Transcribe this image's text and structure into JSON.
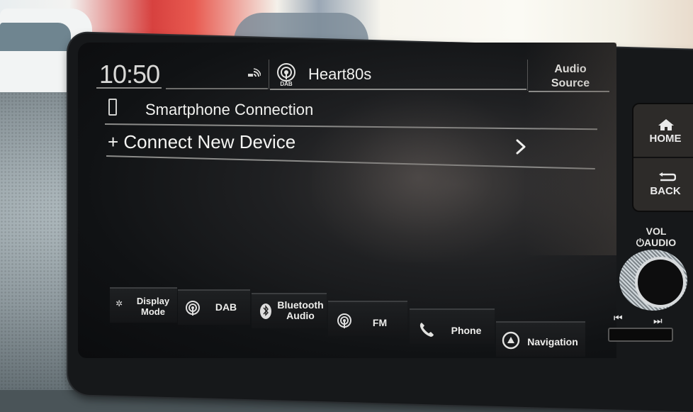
{
  "status_bar": {
    "time": "10:50",
    "signal_icon": "reception-signal-icon",
    "source_icon": "dab-radio-icon",
    "source_badge": "DAB",
    "station": "Heart80s"
  },
  "audio_source_button": {
    "line1": "Audio",
    "line2": "Source"
  },
  "content": {
    "section_icon": "smartphone-icon",
    "section_title": "Smartphone Connection",
    "items": [
      {
        "label": "+ Connect New Device",
        "icon": "chevron-right-icon"
      }
    ]
  },
  "bottom_bar": {
    "buttons": [
      {
        "line1": "Display",
        "line2": "Mode",
        "icon": "display-mode-icon"
      },
      {
        "line1": "DAB",
        "line2": "",
        "icon": "dab-radio-icon"
      },
      {
        "line1": "Bluetooth",
        "line2": "Audio",
        "icon": "bluetooth-icon"
      },
      {
        "line1": "FM",
        "line2": "",
        "icon": "fm-radio-icon"
      },
      {
        "line1": "Phone",
        "line2": "",
        "icon": "phone-icon"
      },
      {
        "line1": "Navigation",
        "line2": "",
        "icon": "navigation-icon"
      }
    ]
  },
  "hardware": {
    "home_label": "HOME",
    "back_label": "BACK",
    "vol_line1": "VOL",
    "vol_line2": "AUDIO",
    "prev_glyph": "⏮",
    "next_glyph": "⏭"
  }
}
